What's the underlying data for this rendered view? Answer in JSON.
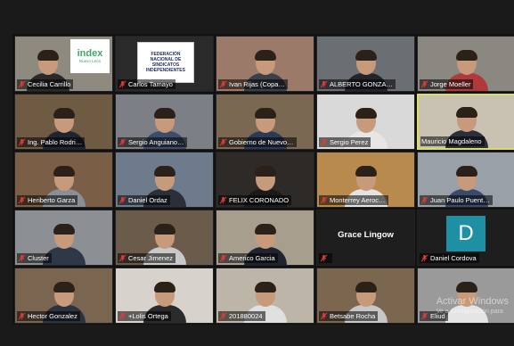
{
  "participants": [
    {
      "name": "Cecilia Carrillo",
      "muted": true,
      "style": "index-logo",
      "bg": "#8f8a80",
      "shirt": "#2a2a2a"
    },
    {
      "name": "Carlos Tamayo",
      "muted": true,
      "style": "org-logo",
      "bg": "#2a2a2a",
      "logo_lines": [
        "FEDERACIÓN",
        "NACIONAL DE",
        "SINDICATOS",
        "INDEPENDIENTES"
      ]
    },
    {
      "name": "Ivan Rijas (Copa…",
      "muted": true,
      "style": "person",
      "bg": "#9b7a6a",
      "shirt": "#3a3f4a"
    },
    {
      "name": "ALBERTO GONZA…",
      "muted": true,
      "style": "person",
      "bg": "#6b6e73",
      "shirt": "#22252a"
    },
    {
      "name": "Jorge Moeller",
      "muted": true,
      "style": "person",
      "bg": "#8a8880",
      "shirt": "#b03a3a"
    },
    {
      "name": "Ing. Pablo Rodri…",
      "muted": true,
      "style": "person",
      "bg": "#6f5a44",
      "shirt": "#1f2530"
    },
    {
      "name": "Sergio Anguiano…",
      "muted": true,
      "style": "person",
      "bg": "#7c7f86",
      "shirt": "#3d4c6b"
    },
    {
      "name": "Gobierno de Nuevo…",
      "muted": true,
      "style": "person",
      "bg": "#7b6852",
      "shirt": "#2c3b55"
    },
    {
      "name": "Sergio Perez",
      "muted": true,
      "style": "person",
      "bg": "#d9d9d9",
      "shirt": "#e6e6e6"
    },
    {
      "name": "Mauricio Magdaleno",
      "muted": false,
      "active": true,
      "style": "person",
      "bg": "#c9c2b3",
      "shirt": "#2a2f3a"
    },
    {
      "name": "Heriberto Garza",
      "muted": true,
      "style": "person",
      "bg": "#7a5e46",
      "shirt": "#8a8e96"
    },
    {
      "name": "Daniel Ordaz",
      "muted": true,
      "style": "person",
      "bg": "#6e7b8c",
      "shirt": "#2a2f3a"
    },
    {
      "name": "FELIX CORONADO",
      "muted": true,
      "style": "person",
      "bg": "#2d2a28",
      "shirt": "#1a1a1a"
    },
    {
      "name": "Monterrey Aeroc…",
      "muted": true,
      "style": "person",
      "bg": "#b88a4e",
      "shirt": "#e4e4e4"
    },
    {
      "name": "Juan Paulo Puent…",
      "muted": true,
      "style": "person",
      "bg": "#9aa0a8",
      "shirt": "#3a4a6a"
    },
    {
      "name": "Cluster",
      "muted": true,
      "style": "person",
      "bg": "#8c8f93",
      "shirt": "#2f3847"
    },
    {
      "name": "Cesar Jimenez",
      "muted": true,
      "style": "person",
      "bg": "#6b5b4b",
      "shirt": "#c9c9c9"
    },
    {
      "name": "Americo Garcia",
      "muted": true,
      "style": "person",
      "bg": "#a89e8e",
      "shirt": "#1f2530"
    },
    {
      "name": "",
      "muted": true,
      "style": "text-only",
      "bg": "#1e1e1e",
      "center_text": "Grace Lingow"
    },
    {
      "name": "Daniel Cordova",
      "muted": true,
      "style": "avatar-d",
      "bg": "#1e1e1e",
      "initial": "D"
    },
    {
      "name": "Hector Gonzalez",
      "muted": true,
      "style": "person",
      "bg": "#7a6650",
      "shirt": "#2b3240"
    },
    {
      "name": "+Lolis Ortega",
      "muted": true,
      "style": "person",
      "bg": "#d7d3cc",
      "shirt": "#2b2b2b"
    },
    {
      "name": "201880024",
      "muted": true,
      "style": "person",
      "bg": "#bdb5a8",
      "shirt": "#e0e0e0"
    },
    {
      "name": "Betsabe Rocha",
      "muted": true,
      "style": "person",
      "bg": "#7b6650",
      "shirt": "#c7c7c7"
    },
    {
      "name": "Eliud",
      "muted": true,
      "style": "person",
      "bg": "#9a9a9a",
      "shirt": "#e5e5e5"
    }
  ],
  "index_logo": {
    "word": "index",
    "sub": "Nuevo León"
  },
  "watermark": {
    "title": "Activar Windows",
    "subtitle": "Ve a Configuración para"
  },
  "colors": {
    "active_border": "#d6e05a",
    "mute_icon": "#e03a3a",
    "avatar": "#1f8fa3"
  }
}
